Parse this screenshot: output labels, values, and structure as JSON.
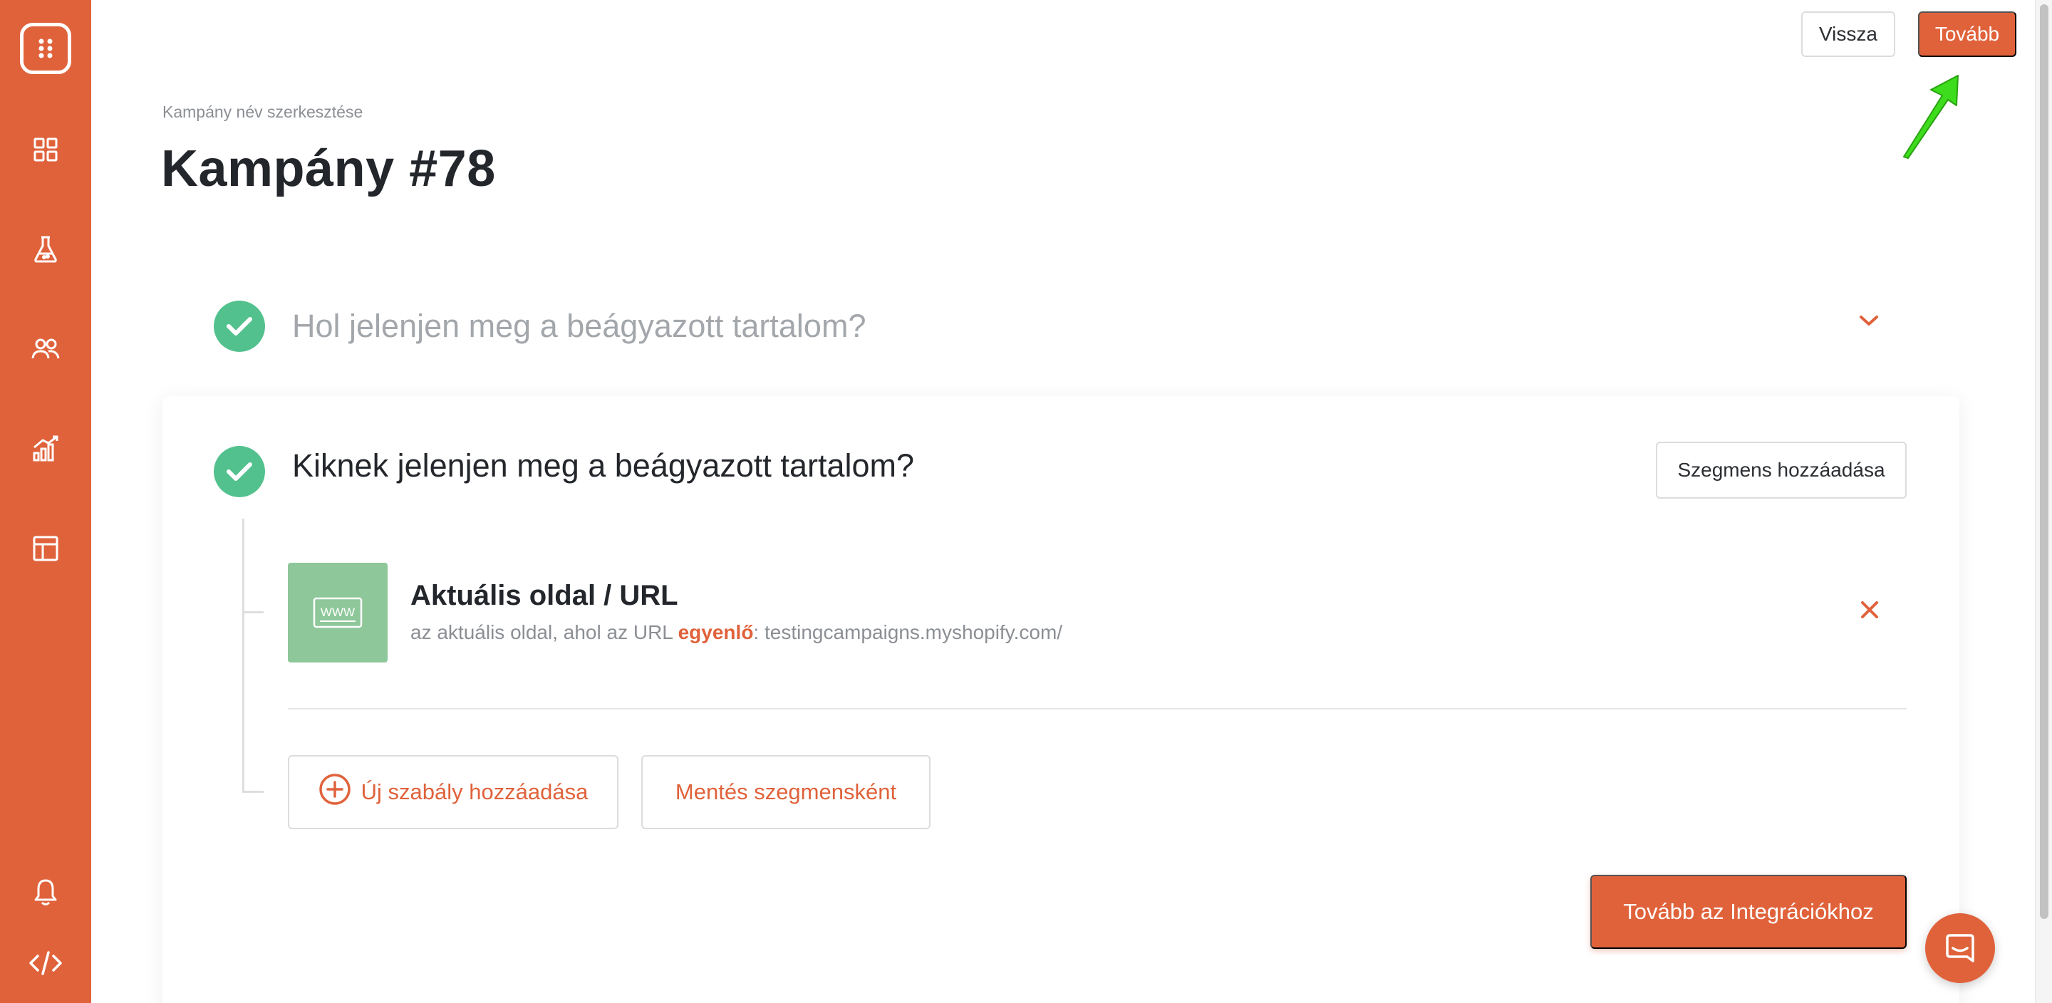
{
  "header": {
    "back_label": "Vissza",
    "next_label": "Tovább"
  },
  "page": {
    "breadcrumb": "Kampány név szerkesztése",
    "title": "Kampány #78"
  },
  "steps": [
    {
      "title": "Hol jelenjen meg a beágyazott tartalom?",
      "status": "completed",
      "state": "collapsed"
    },
    {
      "title": "Kiknek jelenjen meg a beágyazott tartalom?",
      "status": "completed",
      "state": "expanded"
    }
  ],
  "segment": {
    "add_segment_label": "Szegmens hozzáadása",
    "rule": {
      "icon_text": "WWW",
      "title": "Aktuális oldal / URL",
      "desc_prefix": "az aktuális oldal, ahol az URL ",
      "operator": "egyenlő",
      "desc_separator": ": ",
      "value": "testingcampaigns.myshopify.com/"
    },
    "add_rule_label": "Új szabály hozzáadása",
    "save_segment_label": "Mentés szegmensként"
  },
  "footer": {
    "continue_label": "Tovább az Integrációkhoz"
  },
  "sidebar": {
    "items": [
      "logo-icon",
      "dashboard-icon",
      "experiments-icon",
      "users-icon",
      "analytics-icon",
      "layout-icon",
      "notification-icon",
      "code-icon"
    ]
  },
  "colors": {
    "accent": "#e0623b",
    "success": "#52c18e",
    "rule_icon_bg": "#8ec79a",
    "annotation_arrow": "#3ddc1c"
  }
}
